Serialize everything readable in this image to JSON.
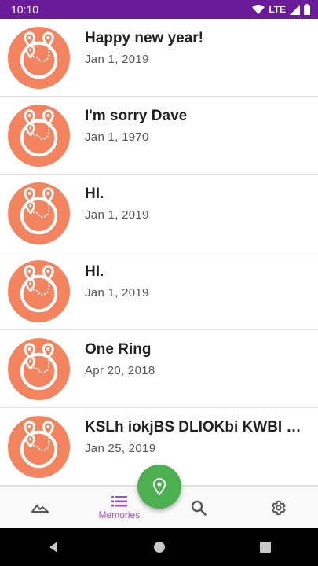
{
  "status_bar": {
    "time": "10:10",
    "network": "LTE",
    "color": "#6a1b9a"
  },
  "memories": [
    {
      "title": "Happy new year!",
      "date": "Jan 1, 2019"
    },
    {
      "title": "I'm sorry Dave",
      "date": "Jan 1, 1970"
    },
    {
      "title": "HI.",
      "date": "Jan 1, 2019"
    },
    {
      "title": "HI.",
      "date": "Jan 1, 2019"
    },
    {
      "title": "One Ring",
      "date": "Apr 20, 2018"
    },
    {
      "title": "KSLh iokjBS DLIOKbi KWBI oLnb",
      "date": "Jan 25, 2019"
    }
  ],
  "bottom_nav": {
    "items": [
      {
        "icon": "terrain-icon",
        "label": ""
      },
      {
        "icon": "list-icon",
        "label": "Memories"
      },
      {
        "icon": "search-icon",
        "label": ""
      },
      {
        "icon": "gear-icon",
        "label": ""
      }
    ],
    "active_color": "#9c4dcc"
  },
  "fab": {
    "icon": "location-pin-icon",
    "color": "#4caf50"
  },
  "avatar_color": "#f4845f"
}
